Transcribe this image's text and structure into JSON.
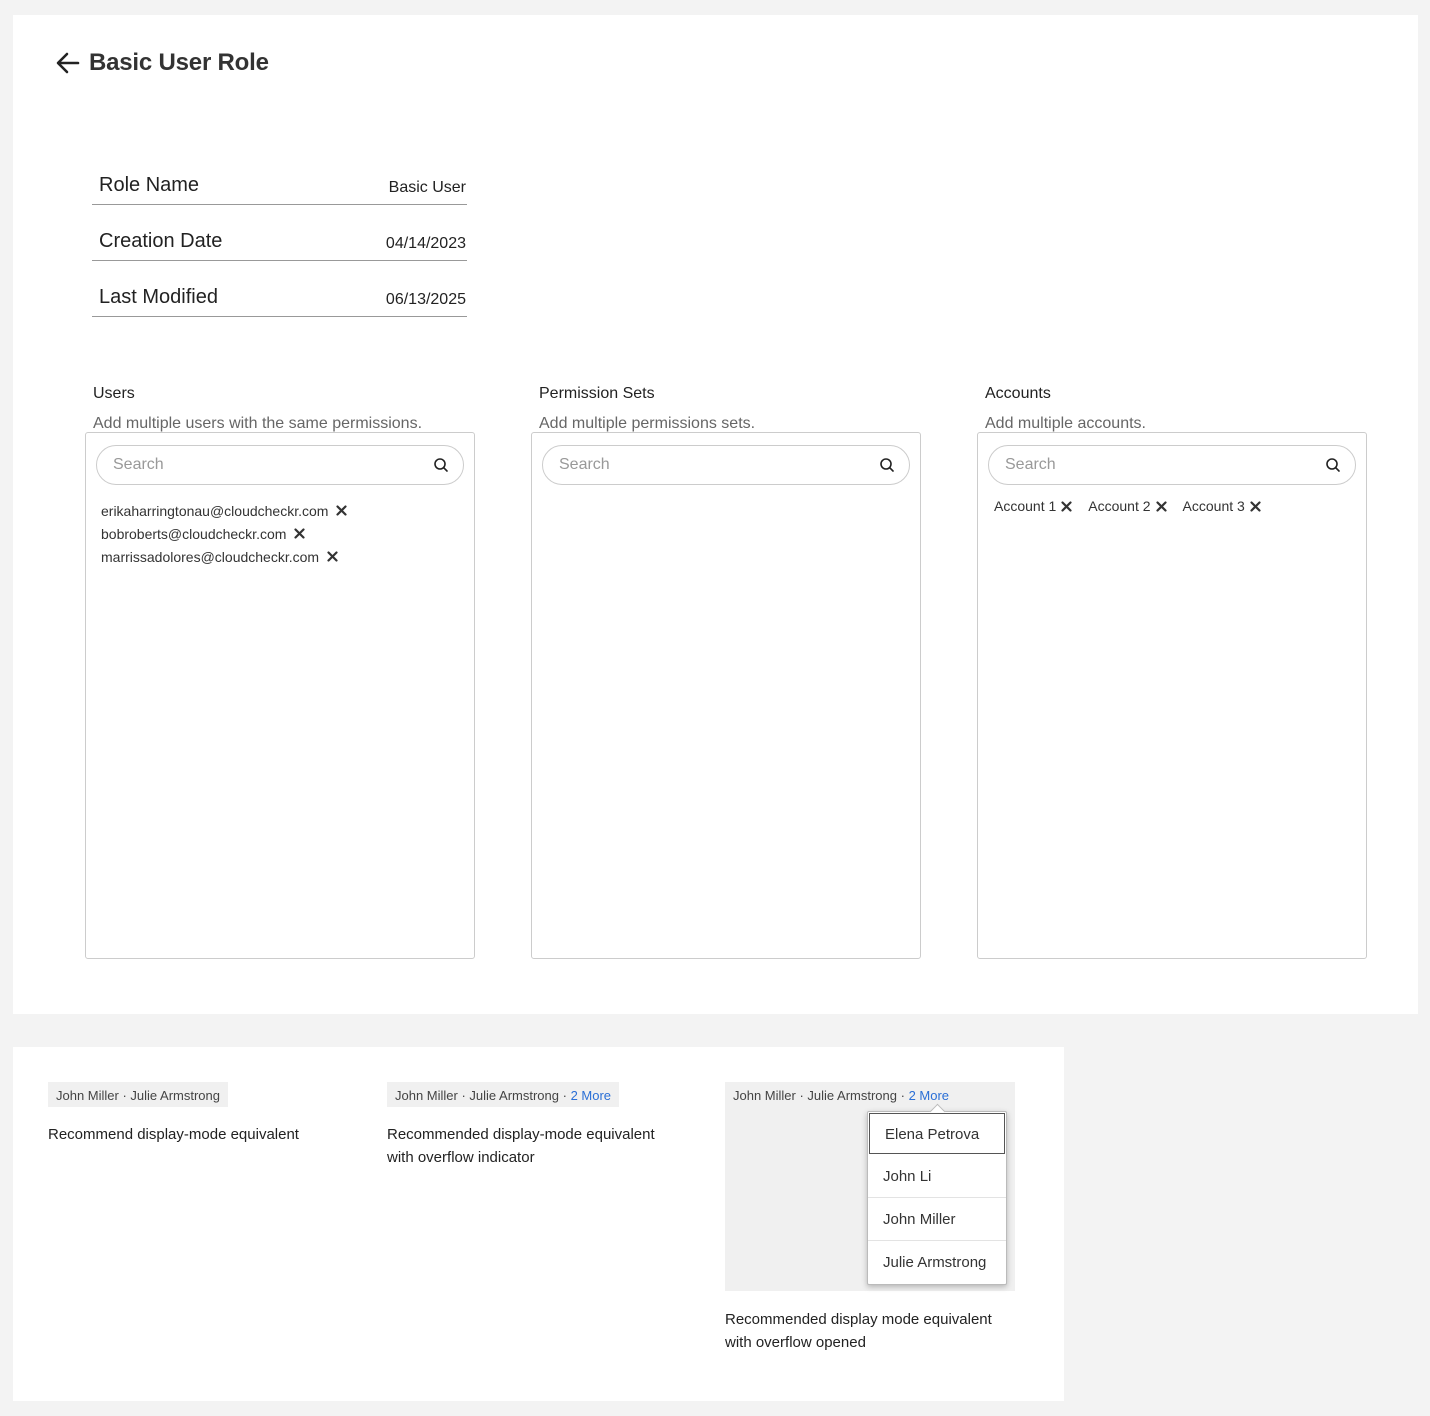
{
  "header": {
    "title": "Basic User Role"
  },
  "info": [
    {
      "label": "Role Name",
      "value": "Basic User"
    },
    {
      "label": "Creation Date",
      "value": "04/14/2023"
    },
    {
      "label": "Last Modified",
      "value": "06/13/2025"
    }
  ],
  "panels": {
    "users": {
      "title": "Users",
      "description": "Add multiple users with the same permissions.",
      "search_placeholder": "Search",
      "items": [
        "erikaharringtonau@cloudcheckr.com",
        "bobroberts@cloudcheckr.com",
        "marrissadolores@cloudcheckr.com"
      ]
    },
    "permission_sets": {
      "title": "Permission Sets",
      "description": "Add multiple permissions sets.",
      "search_placeholder": "Search",
      "items": []
    },
    "accounts": {
      "title": "Accounts",
      "description": "Add multiple accounts.",
      "search_placeholder": "Search",
      "items": [
        "Account 1",
        "Account 2",
        "Account 3"
      ]
    }
  },
  "examples": {
    "names": "John Miller · Julie Armstrong",
    "names_with_sep": "John Miller · Julie Armstrong · ",
    "more": "2 More",
    "caption1": "Recommend display-mode equivalent",
    "caption2_line1": "Recommended display-mode equivalent",
    "caption2_line2": "with overflow indicator",
    "caption3_line1": "Recommended display mode equivalent",
    "caption3_line2": "with overflow opened",
    "menu_items": [
      "Elena Petrova",
      "John Li",
      "John Miller",
      "Julie Armstrong"
    ]
  },
  "colors": {
    "link": "#2a6fd6",
    "chip_bg": "#f0f0f0"
  },
  "icons": {
    "back": "arrow-left-icon",
    "search": "search-icon",
    "remove": "close-icon"
  }
}
